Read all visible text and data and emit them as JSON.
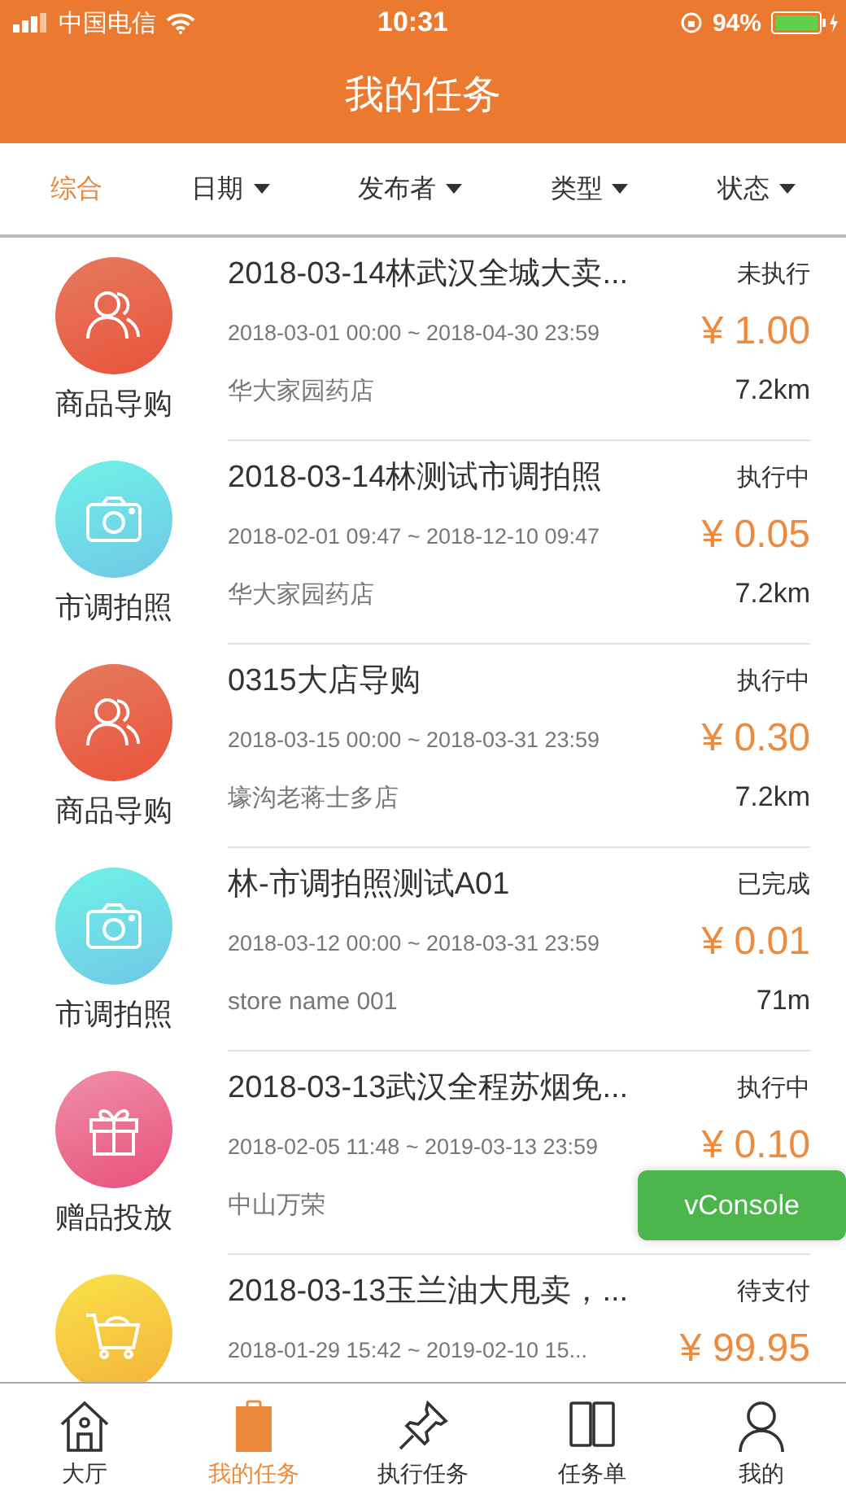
{
  "status_bar": {
    "carrier": "中国电信",
    "time": "10:31",
    "battery": "94%"
  },
  "header": {
    "title": "我的任务"
  },
  "filters": [
    {
      "label": "综合",
      "selected": true,
      "dropdown": false
    },
    {
      "label": "日期",
      "selected": false,
      "dropdown": true
    },
    {
      "label": "发布者",
      "selected": false,
      "dropdown": true
    },
    {
      "label": "类型",
      "selected": false,
      "dropdown": true
    },
    {
      "label": "状态",
      "selected": false,
      "dropdown": true
    }
  ],
  "tasks": [
    {
      "kind": "people",
      "category": "商品导购",
      "title": "2018-03-14林武汉全城大卖...",
      "status": "未执行",
      "period": "2018-03-01 00:00 ~ 2018-04-30 23:59",
      "price": "¥ 1.00",
      "store": "华大家园药店",
      "distance": "7.2km"
    },
    {
      "kind": "camera",
      "category": "市调拍照",
      "title": "2018-03-14林测试市调拍照",
      "status": "执行中",
      "period": "2018-02-01 09:47 ~ 2018-12-10 09:47",
      "price": "¥ 0.05",
      "store": "华大家园药店",
      "distance": "7.2km"
    },
    {
      "kind": "people",
      "category": "商品导购",
      "title": "0315大店导购",
      "status": "执行中",
      "period": "2018-03-15 00:00 ~ 2018-03-31 23:59",
      "price": "¥ 0.30",
      "store": "壕沟老蒋士多店",
      "distance": "7.2km"
    },
    {
      "kind": "camera",
      "category": "市调拍照",
      "title": "林-市调拍照测试A01",
      "status": "已完成",
      "period": "2018-03-12 00:00 ~ 2018-03-31 23:59",
      "price": "¥ 0.01",
      "store": "store name 001",
      "distance": "71m"
    },
    {
      "kind": "gift",
      "category": "赠品投放",
      "title": "2018-03-13武汉全程苏烟免...",
      "status": "执行中",
      "period": "2018-02-05 11:48 ~ 2019-03-13 23:59",
      "price": "¥ 0.10",
      "store": "中山万荣"
    },
    {
      "kind": "cart",
      "title": "2018-03-13玉兰油大甩卖，...",
      "status": "待支付",
      "period": "2018-01-29 15:42 ~ 2019-02-10 15...",
      "price": "¥ 99.95"
    }
  ],
  "console_button": "vConsole",
  "tab_bar": [
    {
      "kind": "home",
      "label": "大厅",
      "selected": false
    },
    {
      "kind": "clipboard",
      "label": "我的任务",
      "selected": true
    },
    {
      "kind": "pin",
      "label": "执行任务",
      "selected": false
    },
    {
      "kind": "list",
      "label": "任务单",
      "selected": false
    },
    {
      "kind": "person",
      "label": "我的",
      "selected": false
    }
  ]
}
